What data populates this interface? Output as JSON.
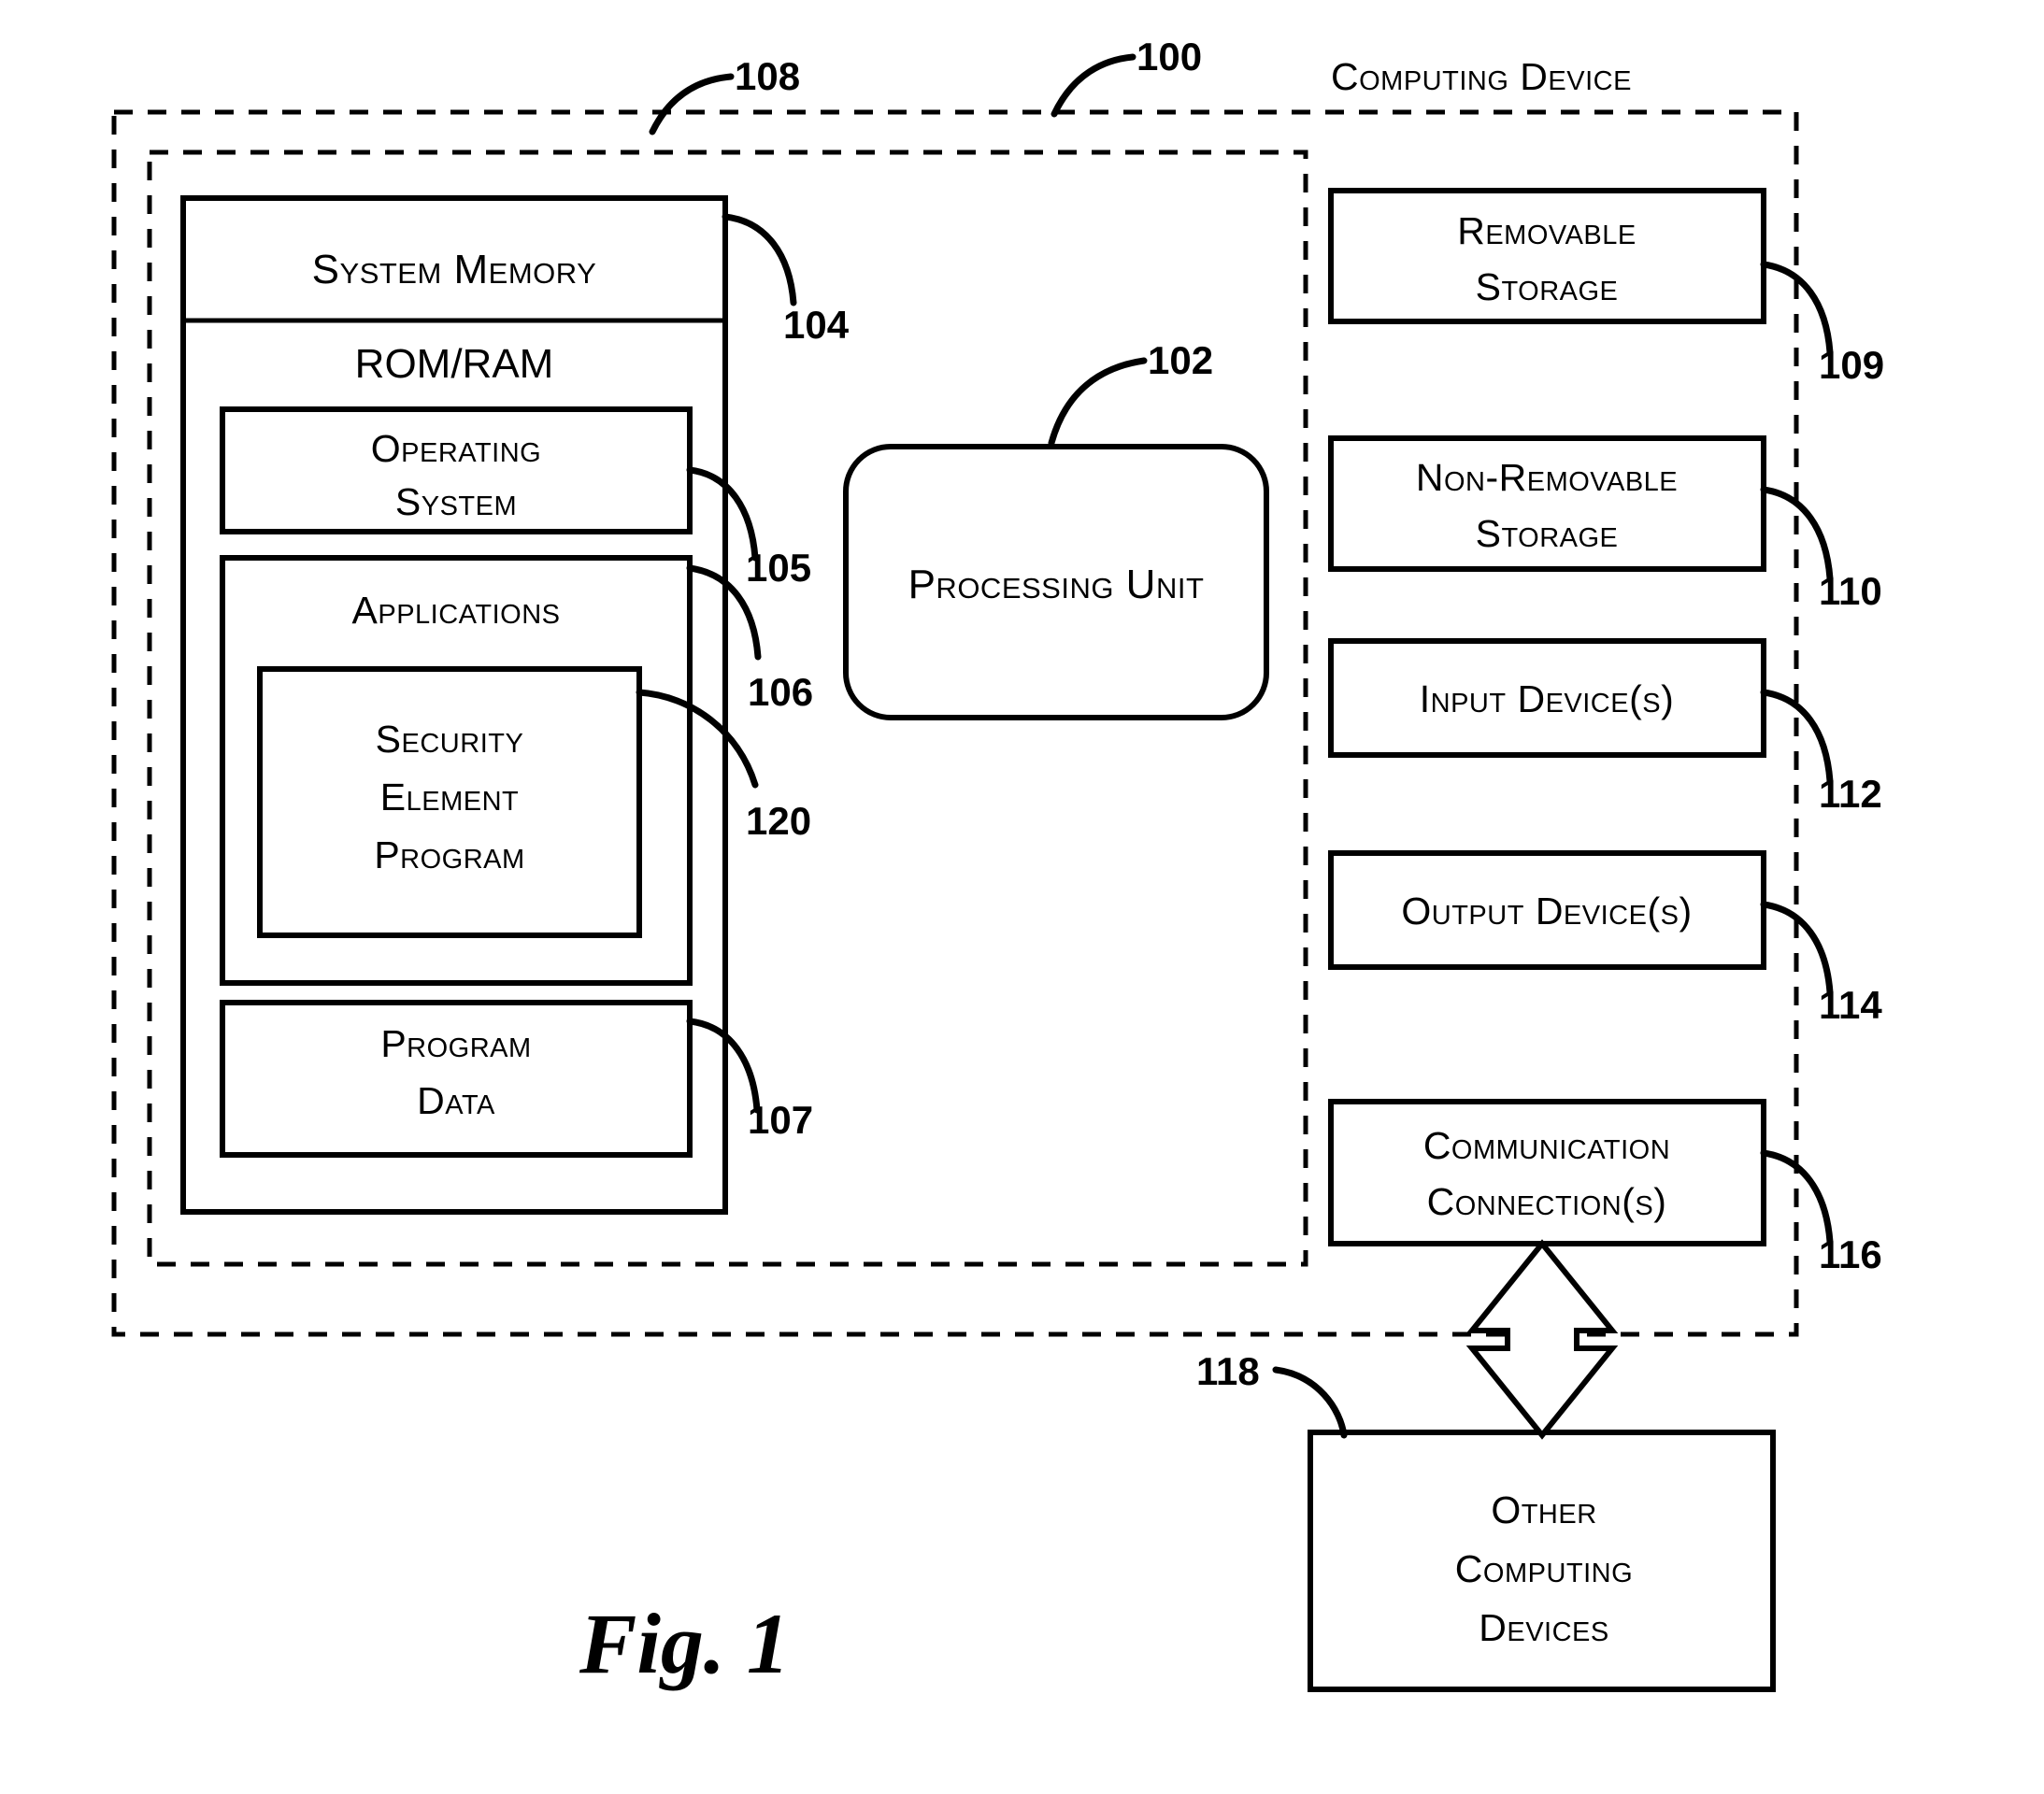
{
  "figure": {
    "caption": "Fig. 1",
    "system_label": "Computing Device"
  },
  "reference_numerals": {
    "system": "100",
    "processing_unit": "102",
    "system_memory": "104",
    "operating_system": "105",
    "applications": "106",
    "program_data": "107",
    "device_boundary": "108",
    "removable_storage": "109",
    "non_removable_storage": "110",
    "input_devices": "112",
    "output_devices": "114",
    "communication_connections": "116",
    "other_computing_devices": "118",
    "security_element_program": "120"
  },
  "memory": {
    "title": "System Memory",
    "rom_ram": "ROM/RAM",
    "operating_system": "Operating System",
    "applications": "Applications",
    "security_element_program": "Security Element Program",
    "program_data": "Program Data"
  },
  "processing": {
    "label": "Processing Unit"
  },
  "peripherals": [
    {
      "label": "Removable Storage",
      "ref": "109"
    },
    {
      "label": "Non-Removable Storage",
      "ref": "110"
    },
    {
      "label": "Input Device(s)",
      "ref": "112"
    },
    {
      "label": "Output Device(s)",
      "ref": "114"
    },
    {
      "label": "Communication Connection(s)",
      "ref": "116"
    }
  ],
  "external": {
    "label": "Other Computing Devices",
    "ref": "118"
  },
  "colors": {
    "ink": "#000000",
    "paper": "#ffffff"
  }
}
